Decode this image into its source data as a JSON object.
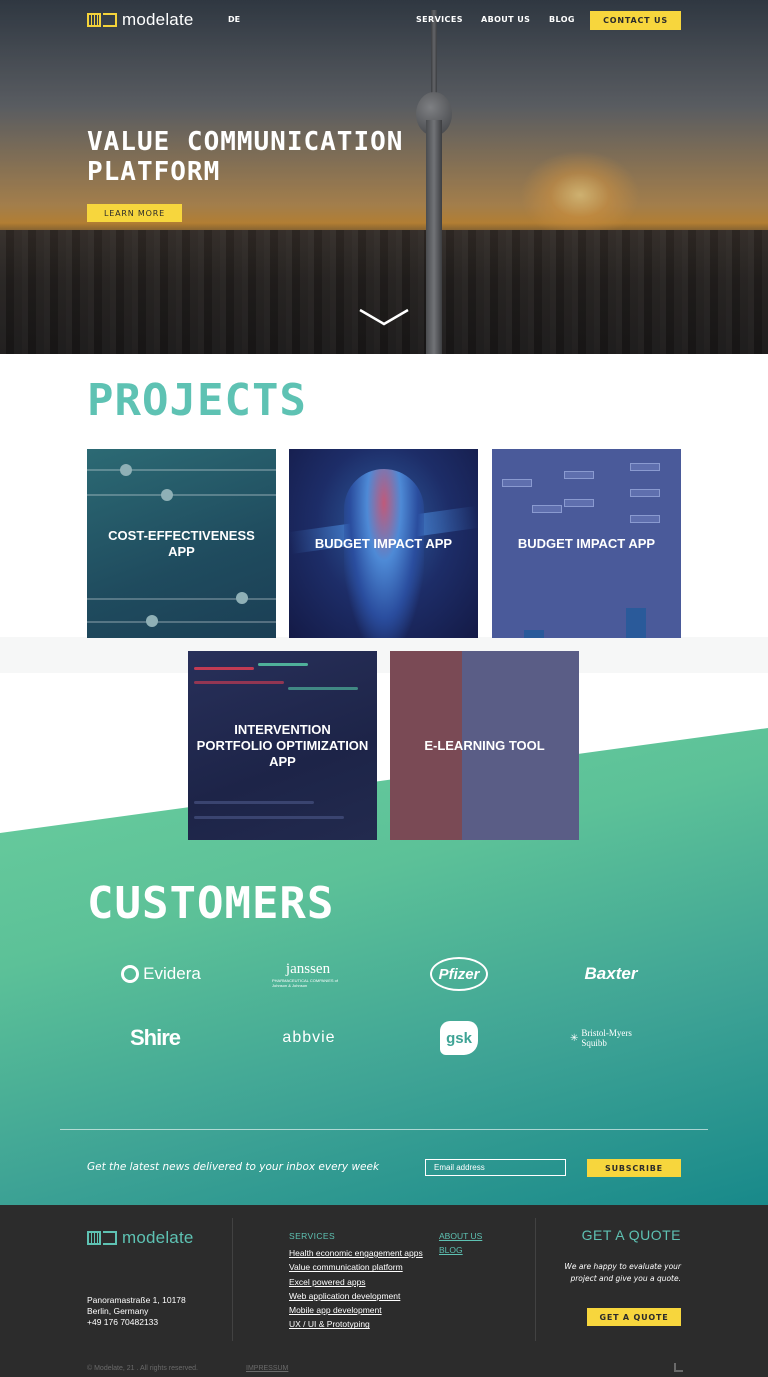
{
  "header": {
    "logo_text": "modelate",
    "language": "DE",
    "nav": {
      "services": "SERVICES",
      "about": "ABOUT US",
      "blog": "BLOG",
      "contact": "CONTACT US"
    }
  },
  "hero": {
    "title": "VALUE COMMUNICATION PLATFORM",
    "cta": "LEARN MORE",
    "scroll_icon": "chevron-down-icon"
  },
  "projects": {
    "title": "PROJECTS",
    "items": [
      {
        "label": "COST-EFFECTIVENESS APP"
      },
      {
        "label": "BUDGET IMPACT APP"
      },
      {
        "label": "BUDGET IMPACT APP"
      },
      {
        "label": "INTERVENTION PORTFOLIO OPTIMIZATION APP"
      },
      {
        "label": "E-LEARNING TOOL"
      }
    ]
  },
  "customers": {
    "title": "CUSTOMERS",
    "logos": [
      {
        "name": "Evidera"
      },
      {
        "name": "janssen",
        "sub": "PHARMACEUTICAL COMPANIES of Johnson & Johnson"
      },
      {
        "name": "Pfizer"
      },
      {
        "name": "Baxter"
      },
      {
        "name": "Shire"
      },
      {
        "name": "abbvie"
      },
      {
        "name": "gsk"
      },
      {
        "name": "Bristol-Myers Squibb"
      }
    ]
  },
  "newsletter": {
    "text": "Get the latest news delivered to your inbox every week",
    "placeholder": "Email address",
    "button": "SUBSCRIBE"
  },
  "footer": {
    "logo_text": "modelate",
    "address": [
      "Panoramastraße 1, 10178",
      "Berlin, Germany",
      "+49 176 70482133"
    ],
    "services_heading": "SERVICES",
    "services": [
      "Health economic engagement apps",
      "Value communication platform",
      "Excel powered apps",
      "Web application development",
      "Mobile app development",
      "UX / UI & Prototyping"
    ],
    "about_link": "ABOUT US",
    "blog_link": "BLOG",
    "quote_title": "GET A QUOTE",
    "quote_text": "We are happy to evaluate your project and give you a quote.",
    "quote_button": "GET A QUOTE",
    "copyright": "© Modelate, 21 . All rights reserved.",
    "impressum": "IMPRESSUM"
  },
  "colors": {
    "accent_yellow": "#f7d63d",
    "accent_teal": "#5ec2b3",
    "footer_bg": "#2c2c2c"
  }
}
